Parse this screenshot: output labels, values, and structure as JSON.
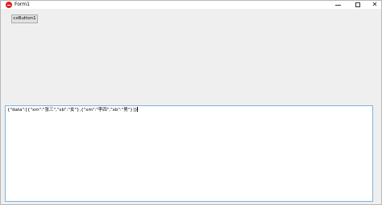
{
  "window": {
    "title": "Form1",
    "icon": "delphi-app-icon"
  },
  "titlebar_controls": {
    "minimize": "minimize-icon",
    "maximize": "maximize-icon",
    "close_glyph": "✕"
  },
  "toolbar": {
    "button_label": "cxButton1"
  },
  "memo": {
    "value": "{\"data\":[{\"xm\":\"张三\",\"xb\":\"女\"},{\"xm\":\"李四\",\"xb\":\"男\"}]}"
  },
  "colors": {
    "client_bg": "#efefef",
    "memo_border": "#7fb3e0",
    "button_bg": "#e1e1e1",
    "app_icon": "#e02020"
  }
}
